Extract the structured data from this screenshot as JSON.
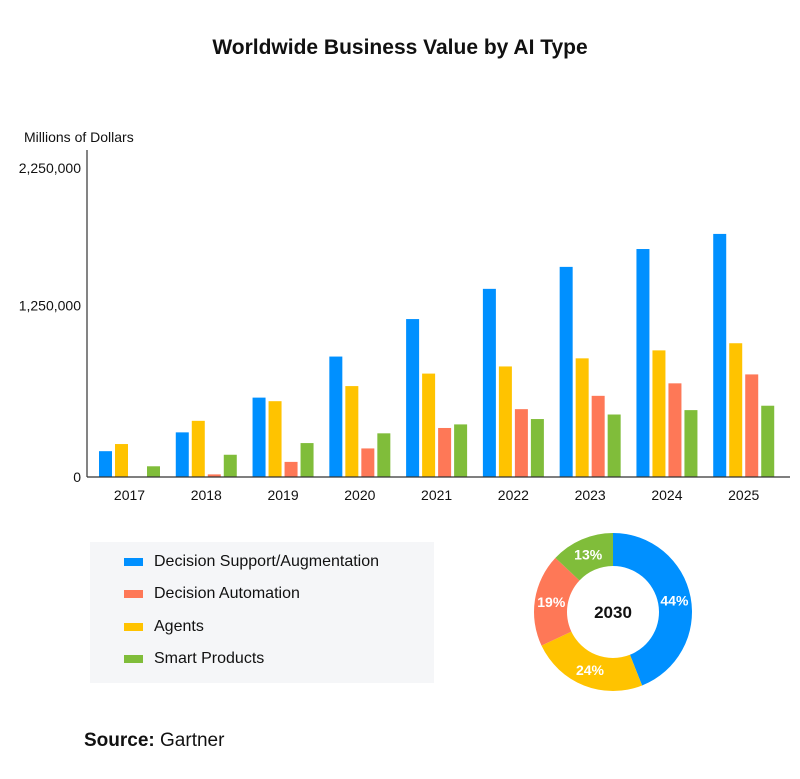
{
  "chart_data": [
    {
      "type": "bar",
      "title": "Worldwide Business Value by AI Type",
      "xlabel": "",
      "ylabel": "Millions of Dollars",
      "ylim": [
        0,
        2250000
      ],
      "yticks": [
        0,
        1250000,
        2250000
      ],
      "ytick_labels": [
        "0",
        "1,250,000",
        "2,250,000"
      ],
      "grid": false,
      "categories": [
        "2017",
        "2018",
        "2019",
        "2020",
        "2021",
        "2022",
        "2023",
        "2024",
        "2025"
      ],
      "series": [
        {
          "name": "Decision Support/Augmentation",
          "color": "#0090ff",
          "values": [
            188000,
            325000,
            578000,
            877000,
            1150000,
            1370000,
            1530000,
            1660000,
            1770000
          ]
        },
        {
          "name": "Agents",
          "color": "#ffc300",
          "values": [
            240000,
            409000,
            552000,
            662000,
            753000,
            805000,
            864000,
            922000,
            974000
          ]
        },
        {
          "name": "Decision Automation",
          "color": "#fe7857",
          "values": [
            0,
            19000,
            110000,
            208000,
            357000,
            494000,
            591000,
            682000,
            747000
          ]
        },
        {
          "name": "Smart Products",
          "color": "#80bd3a",
          "values": [
            78000,
            162000,
            247000,
            318000,
            383000,
            422000,
            455000,
            487000,
            519000
          ]
        }
      ],
      "legend_position": "bottom-left"
    },
    {
      "type": "pie",
      "title": "2030",
      "center_label": "2030",
      "slices": [
        {
          "name": "Decision Support/Augmentation",
          "value": 44,
          "label": "44%",
          "color": "#0090ff"
        },
        {
          "name": "Agents",
          "value": 24,
          "label": "24%",
          "color": "#ffc300"
        },
        {
          "name": "Decision Automation",
          "value": 19,
          "label": "19%",
          "color": "#fe7857"
        },
        {
          "name": "Smart Products",
          "value": 13,
          "label": "13%",
          "color": "#80bd3a"
        }
      ]
    }
  ],
  "legend": [
    {
      "label": "Decision Support/Augmentation",
      "color": "#0090ff"
    },
    {
      "label": "Decision Automation",
      "color": "#fe7857"
    },
    {
      "label": "Agents",
      "color": "#ffc300"
    },
    {
      "label": "Smart Products",
      "color": "#80bd3a"
    }
  ],
  "source": {
    "prefix": "Source:",
    "name": "Gartner"
  }
}
